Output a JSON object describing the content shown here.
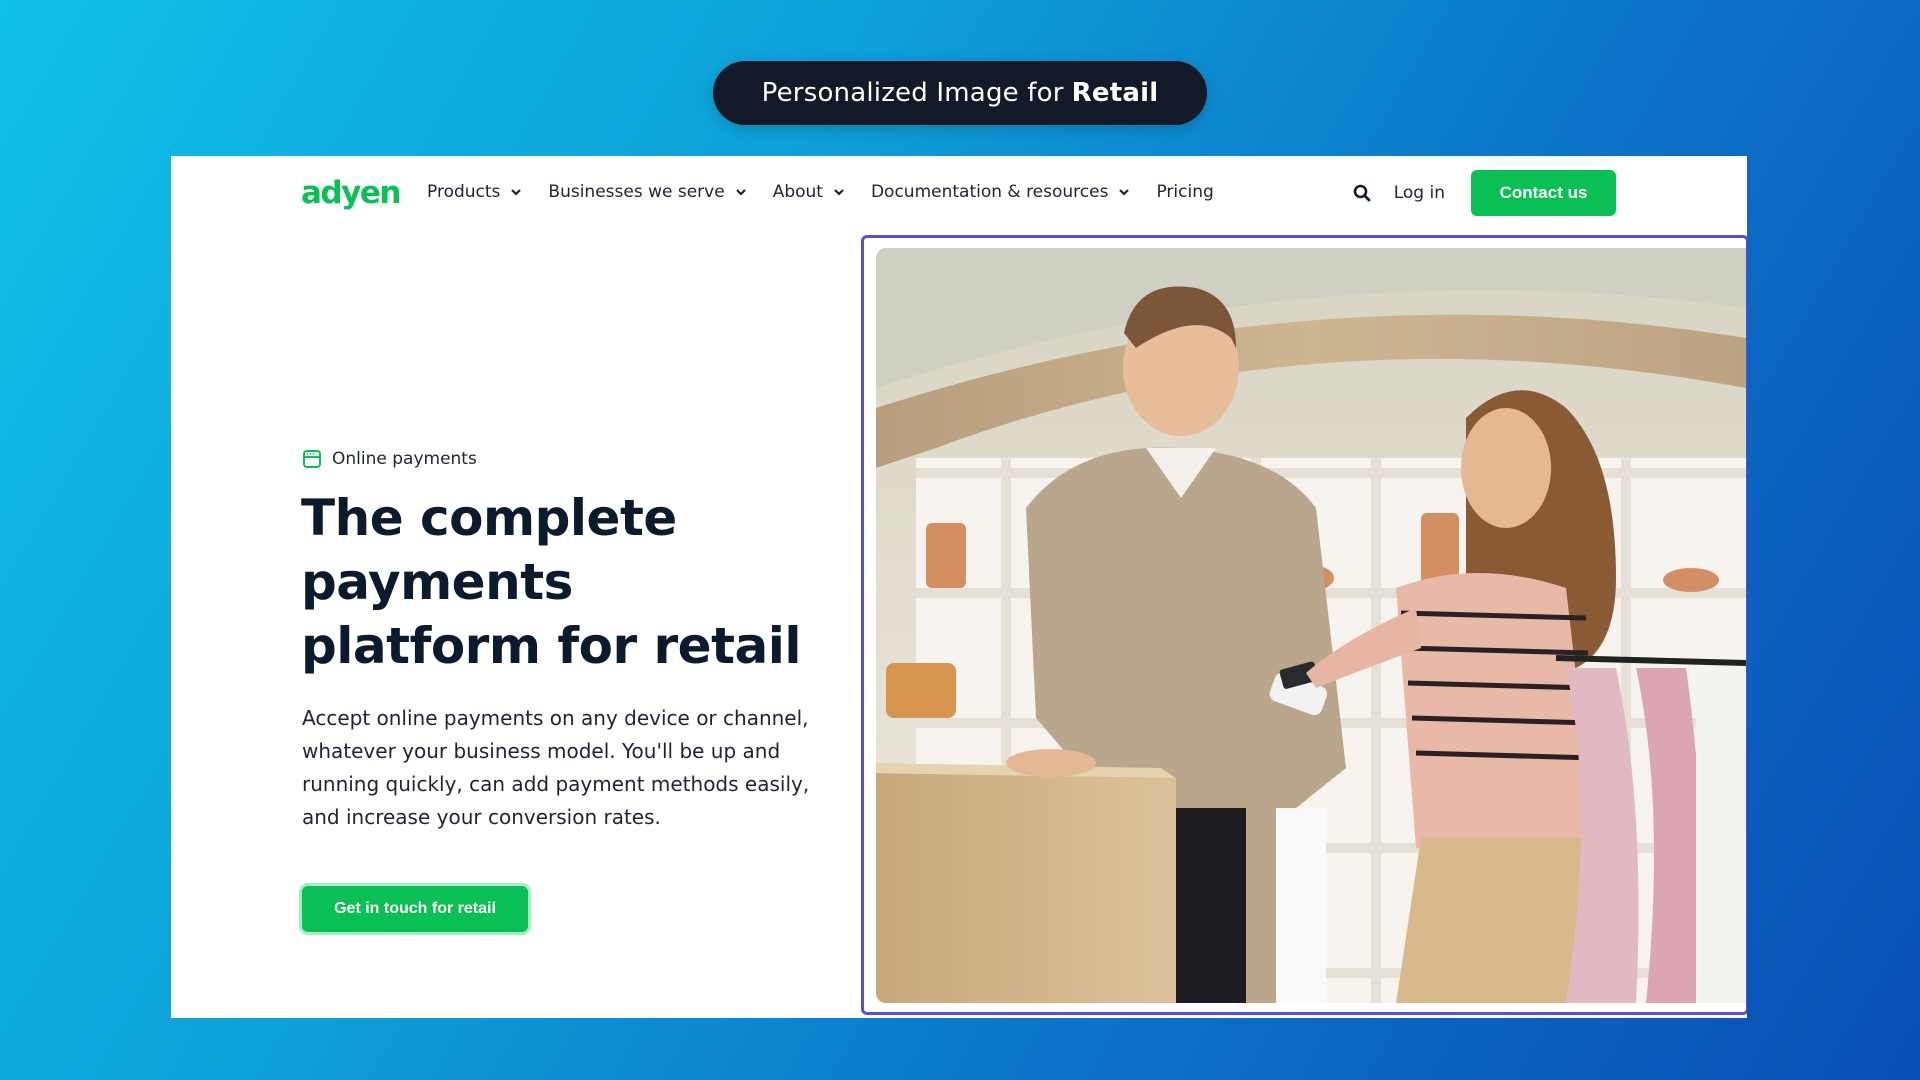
{
  "banner": {
    "prefix": "Personalized Image for",
    "highlight": "Retail"
  },
  "nav": {
    "logo_text": "adyen",
    "items": [
      {
        "label": "Products",
        "has_dropdown": true
      },
      {
        "label": "Businesses we serve",
        "has_dropdown": true
      },
      {
        "label": "About",
        "has_dropdown": true
      },
      {
        "label": "Documentation & resources",
        "has_dropdown": true
      },
      {
        "label": "Pricing",
        "has_dropdown": false
      }
    ],
    "search_icon": "search-icon",
    "login_label": "Log in",
    "contact_label": "Contact us"
  },
  "hero": {
    "tag_icon": "browser-window-icon",
    "tag_label": "Online payments",
    "headline": "The complete payments platform for retail",
    "description": "Accept online payments on any device or channel, whatever your business model. You'll be up and running quickly, can add payment methods easily, and increase your conversion rates.",
    "cta_label": "Get in touch for retail",
    "image_alt": "Retail store clerk holding a card payment terminal while a customer taps her card"
  },
  "colors": {
    "brand_green": "#0abf53",
    "headline": "#0c1a2e",
    "frame_border": "#5a4fcf",
    "banner_bg": "#121a2a"
  }
}
